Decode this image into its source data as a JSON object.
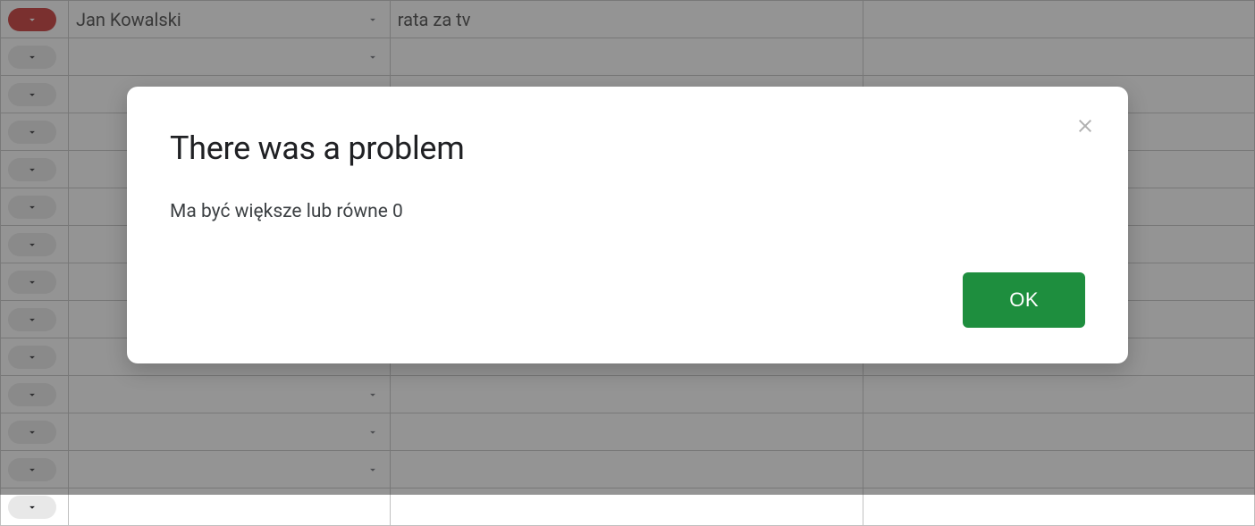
{
  "spreadsheet": {
    "rows": [
      {
        "col_a_variant": "red",
        "col_b": "Jan Kowalski",
        "col_c": "rata za tv",
        "has_b_dropdown": true
      },
      {
        "col_a_variant": "grey",
        "col_b": "",
        "col_c": "",
        "has_b_dropdown": true
      },
      {
        "col_a_variant": "grey",
        "col_b": "",
        "col_c": "",
        "has_b_dropdown": true
      },
      {
        "col_a_variant": "grey",
        "col_b": "",
        "col_c": "",
        "has_b_dropdown": false
      },
      {
        "col_a_variant": "grey",
        "col_b": "",
        "col_c": "",
        "has_b_dropdown": false
      },
      {
        "col_a_variant": "grey",
        "col_b": "",
        "col_c": "",
        "has_b_dropdown": false
      },
      {
        "col_a_variant": "grey",
        "col_b": "",
        "col_c": "",
        "has_b_dropdown": false
      },
      {
        "col_a_variant": "grey",
        "col_b": "",
        "col_c": "",
        "has_b_dropdown": false
      },
      {
        "col_a_variant": "grey",
        "col_b": "",
        "col_c": "",
        "has_b_dropdown": false
      },
      {
        "col_a_variant": "grey",
        "col_b": "",
        "col_c": "",
        "has_b_dropdown": false
      },
      {
        "col_a_variant": "grey",
        "col_b": "",
        "col_c": "",
        "has_b_dropdown": true
      },
      {
        "col_a_variant": "grey",
        "col_b": "",
        "col_c": "",
        "has_b_dropdown": true
      },
      {
        "col_a_variant": "grey",
        "col_b": "",
        "col_c": "",
        "has_b_dropdown": true
      },
      {
        "col_a_variant": "grey",
        "col_b": "",
        "col_c": "",
        "has_b_dropdown": false
      }
    ]
  },
  "dialog": {
    "title": "There was a problem",
    "message": "Ma być większe lub równe 0",
    "ok_label": "OK"
  }
}
